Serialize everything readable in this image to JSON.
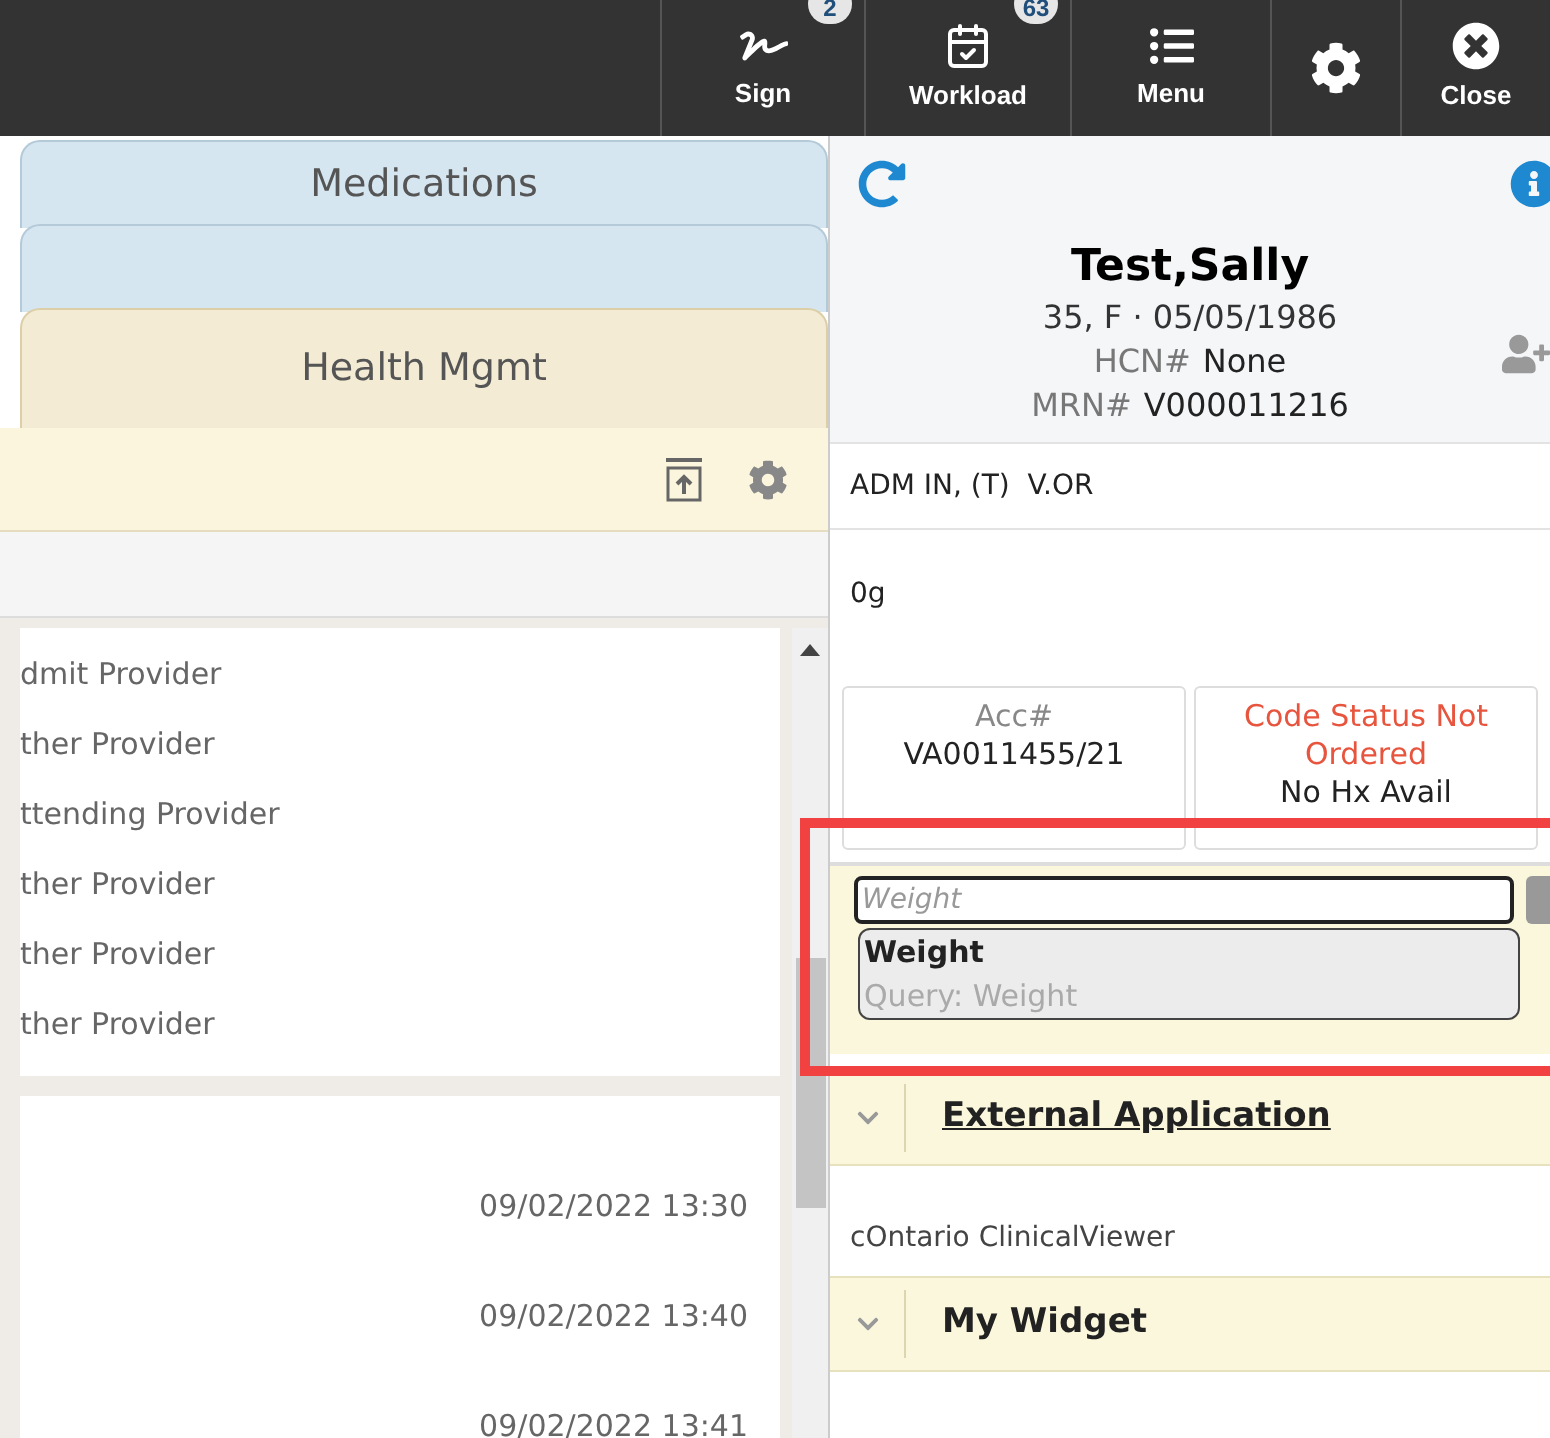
{
  "toolbar": {
    "buttons": [
      {
        "kind": "sign",
        "label": "Sign",
        "badge": "2"
      },
      {
        "kind": "workload",
        "label": "Workload",
        "badge": "63"
      },
      {
        "kind": "menu",
        "label": "Menu"
      },
      {
        "kind": "settings"
      },
      {
        "kind": "close",
        "label": "Close"
      }
    ]
  },
  "tabs": [
    {
      "label": "Medications",
      "selected": false
    },
    {
      "selected": false
    },
    {
      "label": "Health Mgmt",
      "selected": true
    }
  ],
  "providers": [
    "dmit Provider",
    "ther Provider",
    "ttending Provider",
    "ther Provider",
    "ther Provider",
    "ther Provider"
  ],
  "timestamps": [
    "09/02/2022 13:30",
    "09/02/2022 13:40",
    "09/02/2022 13:41"
  ],
  "patient": {
    "name": "Test,Sally",
    "demographics": "35, F · 05/05/1986",
    "hcn_label": "HCN#",
    "hcn": "None",
    "mrn_label": "MRN#",
    "mrn": "V000011216"
  },
  "encounter": "ADM IN, (T)  V.OR",
  "weight": "0g",
  "cards": [
    {
      "kind": "info",
      "title": "Acc#",
      "value": "VA0011455/21"
    },
    {
      "kind": "alert",
      "title": "Code Status Not Ordered",
      "value": "No Hx Avail"
    }
  ],
  "search": {
    "placeholder": "Weight"
  },
  "suggestions": [
    {
      "title": "Weight",
      "subtitle": "Query: Weight"
    }
  ],
  "sections": [
    {
      "title": "External Application",
      "link": true,
      "items": [
        "cOntario ClinicalViewer"
      ]
    },
    {
      "title": "My Widget",
      "link": false
    }
  ]
}
